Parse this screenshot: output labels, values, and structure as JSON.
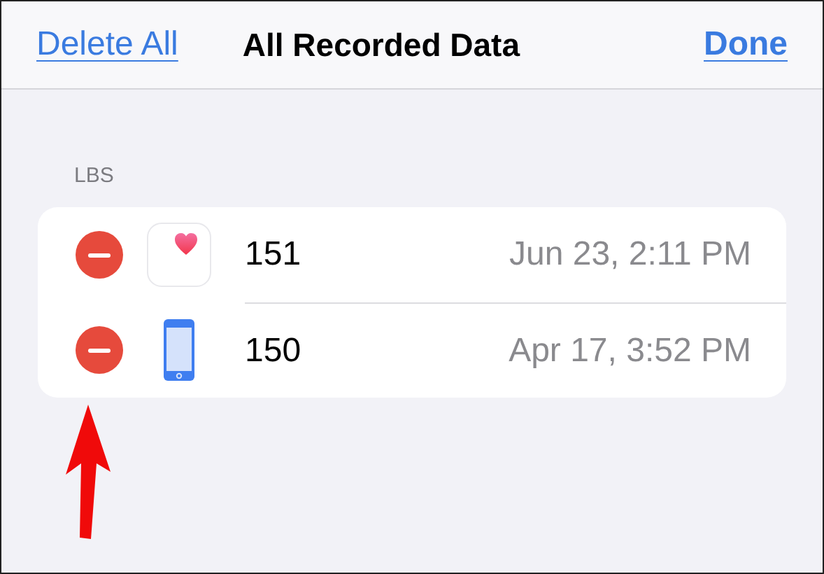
{
  "nav_bar": {
    "left_button": "Delete All",
    "title": "All Recorded Data",
    "right_button": "Done"
  },
  "section": {
    "header": "LBS",
    "rows": [
      {
        "kind": "health",
        "value": "151",
        "date": "Jun 23, 2:11 PM"
      },
      {
        "kind": "phone",
        "value": "150",
        "date": "Apr 17, 3:52 PM"
      }
    ]
  }
}
